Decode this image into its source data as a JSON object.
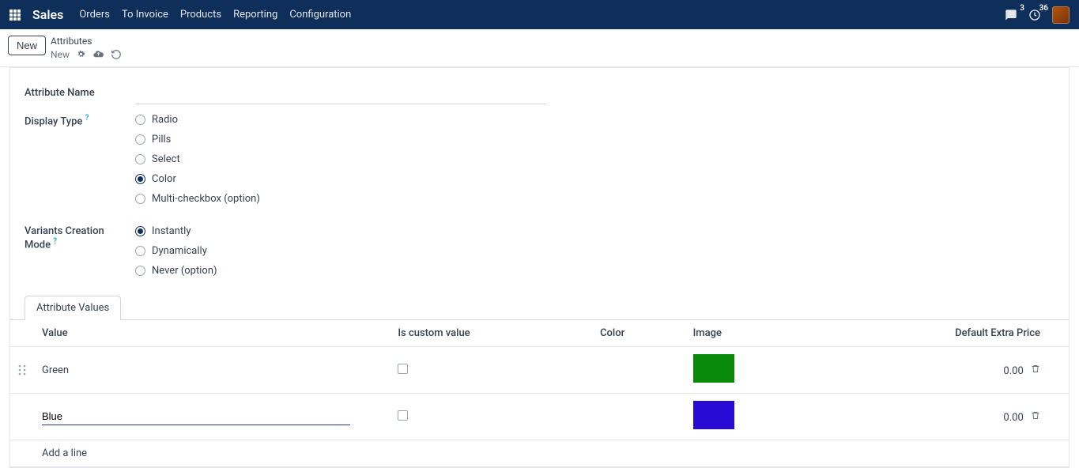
{
  "nav": {
    "brand": "Sales",
    "items": [
      "Orders",
      "To Invoice",
      "Products",
      "Reporting",
      "Configuration"
    ],
    "msg_badge": "3",
    "activity_badge": "36"
  },
  "control": {
    "new_btn": "New",
    "crumb_top": "Attributes",
    "crumb_bottom": "New"
  },
  "form": {
    "attr_name_label": "Attribute Name",
    "attr_name_value": "",
    "display_type_label": "Display Type",
    "display_type_options": [
      {
        "label": "Radio",
        "checked": false
      },
      {
        "label": "Pills",
        "checked": false
      },
      {
        "label": "Select",
        "checked": false
      },
      {
        "label": "Color",
        "checked": true
      },
      {
        "label": "Multi-checkbox (option)",
        "checked": false
      }
    ],
    "variants_mode_label": "Variants Creation Mode",
    "variants_mode_options": [
      {
        "label": "Instantly",
        "checked": true
      },
      {
        "label": "Dynamically",
        "checked": false
      },
      {
        "label": "Never (option)",
        "checked": false
      }
    ]
  },
  "tab": {
    "label": "Attribute Values"
  },
  "table": {
    "headers": {
      "value": "Value",
      "custom": "Is custom value",
      "color": "Color",
      "image": "Image",
      "price": "Default Extra Price"
    },
    "rows": [
      {
        "value": "Green",
        "custom": false,
        "swatch": "#0a8a0a",
        "price": "0.00"
      },
      {
        "value": "Blue",
        "custom": false,
        "swatch": "#2a0bd6",
        "price": "0.00"
      }
    ],
    "add_line": "Add a line"
  }
}
